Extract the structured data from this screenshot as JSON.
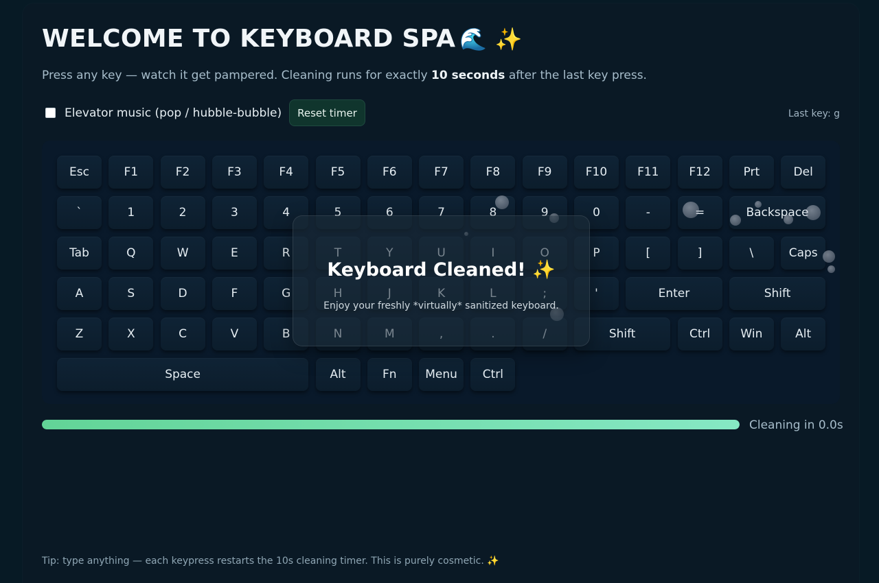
{
  "header": {
    "title": "WELCOME TO KEYBOARD SPA",
    "title_emoji": "🌊 ✨",
    "subtitle_before": "Press any key — watch it get pampered. Cleaning runs for exactly ",
    "subtitle_bold": "10 seconds",
    "subtitle_after": " after the last key press."
  },
  "controls": {
    "music_label": "Elevator music (pop / hubble-bubble)",
    "music_checked": false,
    "reset_label": "Reset timer",
    "last_key": "Last key: g"
  },
  "keyboard": {
    "rows": [
      [
        "Esc",
        "F1",
        "F2",
        "F3",
        "F4",
        "F5",
        "F6",
        "F7",
        "F8",
        "F9",
        "F10",
        "F11",
        "F12",
        "Prt",
        "Del"
      ],
      [
        "`",
        "1",
        "2",
        "3",
        "4",
        "5",
        "6",
        "7",
        "8",
        "9",
        "0",
        "-",
        "=",
        "Backspace"
      ],
      [
        "Tab",
        "Q",
        "W",
        "E",
        "R",
        "T",
        "Y",
        "U",
        "I",
        "O",
        "P",
        "[",
        "]",
        "\\",
        "Caps"
      ],
      [
        "A",
        "S",
        "D",
        "F",
        "G",
        "H",
        "J",
        "K",
        "L",
        ";",
        "'",
        "Enter",
        "Shift"
      ],
      [
        "Z",
        "X",
        "C",
        "V",
        "B",
        "N",
        "M",
        ",",
        ".",
        "/",
        "Shift",
        "Ctrl",
        "Win",
        "Alt"
      ],
      [
        "Space",
        "Alt",
        "Fn",
        "Menu",
        "Ctrl"
      ]
    ]
  },
  "modal": {
    "title": "Keyboard Cleaned! ✨",
    "subtitle": "Enjoy your freshly *virtually* sanitized keyboard."
  },
  "progress": {
    "fill_fraction": 1.0,
    "label": "Cleaning in 0.0s"
  },
  "footer": {
    "tip": "Tip: type anything — each keypress restarts the 10s cleaning timer. This is purely cosmetic. ✨"
  },
  "colors": {
    "background": "#071a25",
    "panel": "#0a1925",
    "key": "#0f2335",
    "progress_start": "#62d497",
    "progress_end": "#86e8c4",
    "reset_button": "#10352d"
  }
}
